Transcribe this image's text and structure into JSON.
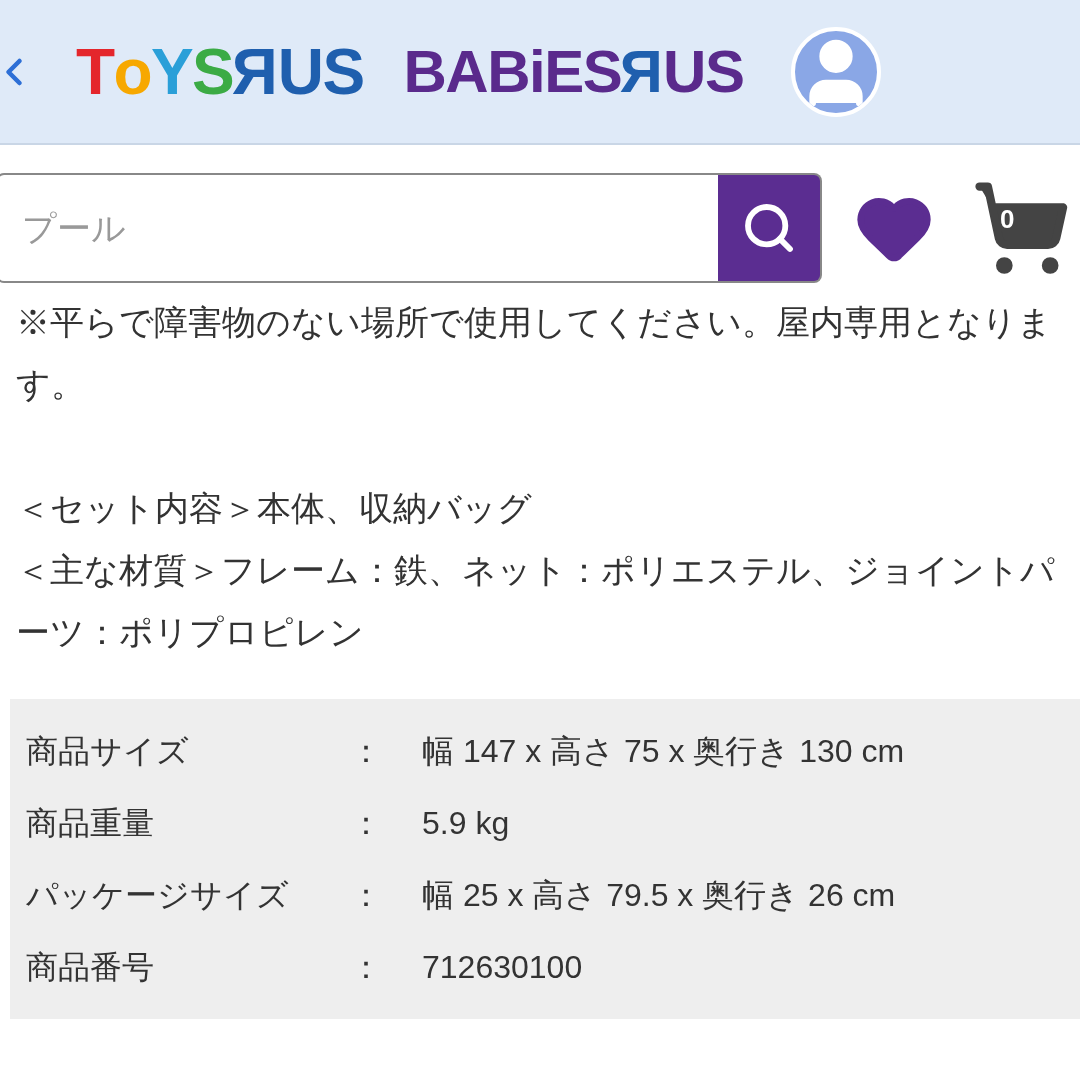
{
  "header": {
    "logos": [
      {
        "kind": "toys",
        "parts": [
          "T",
          "o",
          "Y",
          "S",
          "R",
          "US"
        ]
      },
      {
        "kind": "babies",
        "parts": [
          "BABiES",
          "R",
          "US"
        ]
      }
    ]
  },
  "search": {
    "placeholder": "プール"
  },
  "cart": {
    "count": "0"
  },
  "paragraphs": [
    [
      "※平らで障害物のない場所で使用してください。屋内専用となります。"
    ],
    [
      "＜セット内容＞本体、収納バッグ",
      "＜主な材質＞フレーム：鉄、ネット：ポリエステル、ジョイントパーツ：ポリプロピレン"
    ]
  ],
  "specs": [
    {
      "label": "商品サイズ",
      "separator": "：",
      "value": "幅 147 x 高さ 75 x 奥行き 130 cm"
    },
    {
      "label": "商品重量",
      "separator": "：",
      "value": "5.9 kg"
    },
    {
      "label": "パッケージサイズ",
      "separator": "：",
      "value": "幅 25 x 高さ 79.5 x 奥行き 26 cm"
    },
    {
      "label": "商品番号",
      "separator": "：",
      "value": "712630100"
    }
  ]
}
